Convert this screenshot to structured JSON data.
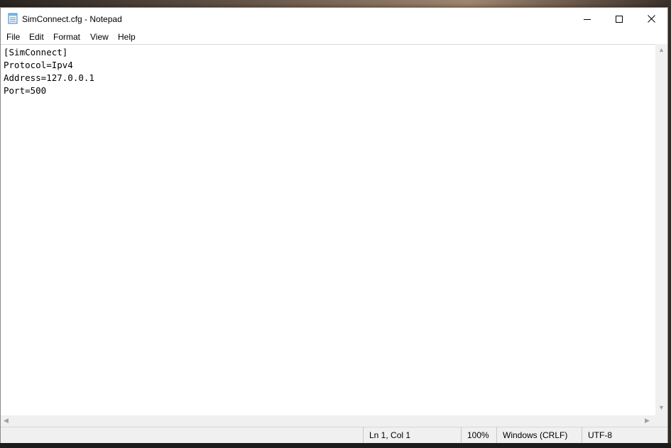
{
  "window": {
    "title": "SimConnect.cfg - Notepad",
    "app_icon": "notepad-icon",
    "controls": {
      "minimize": "minimize-icon",
      "maximize": "maximize-icon",
      "close": "close-icon"
    }
  },
  "menu": {
    "items": [
      "File",
      "Edit",
      "Format",
      "View",
      "Help"
    ]
  },
  "editor": {
    "lines": [
      "[SimConnect]",
      "Protocol=Ipv4",
      "Address=127.0.0.1",
      "Port=500"
    ]
  },
  "status": {
    "position": "Ln 1, Col 1",
    "zoom": "100%",
    "line_ending": "Windows (CRLF)",
    "encoding": "UTF-8"
  },
  "colors": {
    "window_bg": "#ffffff",
    "statusbar_bg": "#f0f0f0",
    "text": "#000000"
  }
}
